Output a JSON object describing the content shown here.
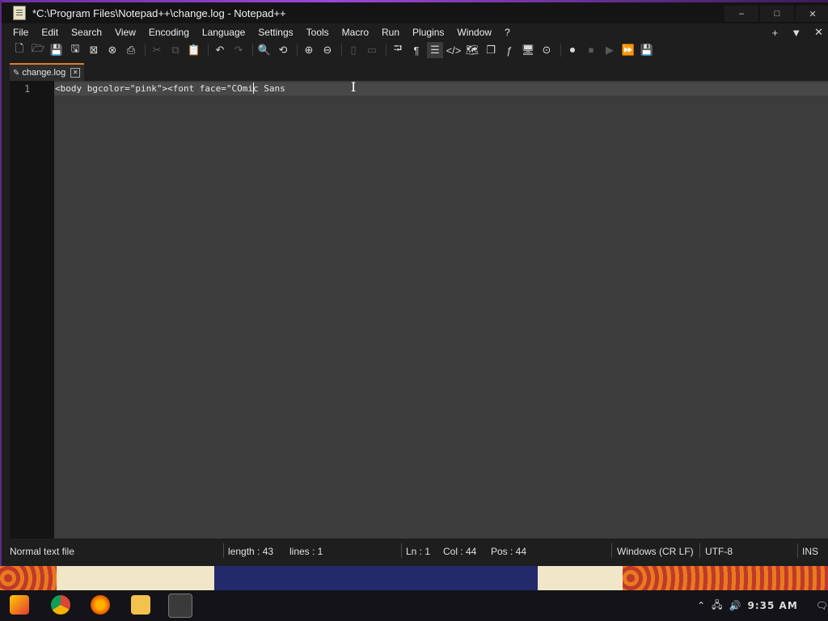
{
  "window": {
    "title": "*C:\\Program Files\\Notepad++\\change.log - Notepad++",
    "controls": [
      "–",
      "□",
      "✕"
    ]
  },
  "menu": {
    "items": [
      "File",
      "Edit",
      "Search",
      "View",
      "Encoding",
      "Language",
      "Settings",
      "Tools",
      "Macro",
      "Run",
      "Plugins",
      "Window",
      "?"
    ],
    "right": [
      "+",
      "▼",
      "✕"
    ]
  },
  "tab": {
    "name": "change.log"
  },
  "editor": {
    "line_number": "1",
    "content": "<body bgcolor=\"pink\"><font face=\"COmic Sans"
  },
  "status": {
    "file_type": "Normal text file",
    "length": "length : 43",
    "lines": "lines : 1",
    "ln": "Ln : 1",
    "col": "Col : 44",
    "pos": "Pos : 44",
    "eol": "Windows (CR LF)",
    "encoding": "UTF-8",
    "mode": "INS"
  },
  "taskbar": {
    "time": "9:35 AM"
  },
  "colors": {
    "accent": "#e07b2a",
    "chrome_border": "#6b2fa0"
  }
}
